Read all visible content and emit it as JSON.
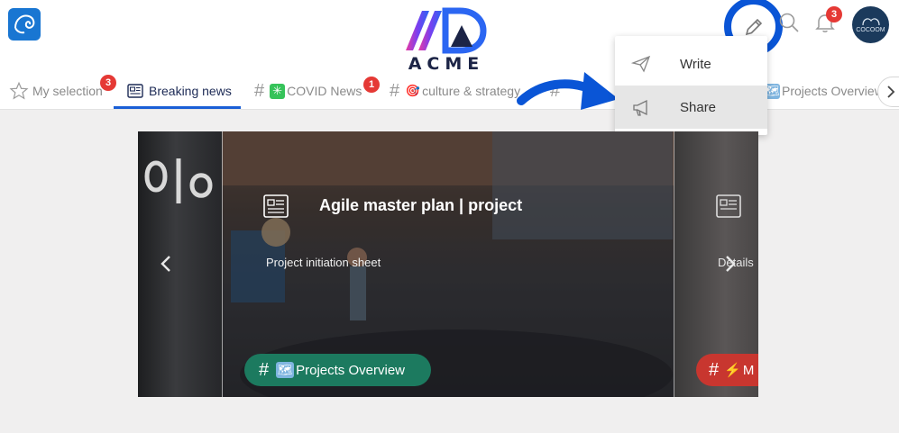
{
  "header": {
    "brand_name": "ACME",
    "notifications_count": "3",
    "avatar_label": "COCOOM"
  },
  "menu": {
    "items": [
      {
        "label": "Write",
        "icon": "paper-plane-icon"
      },
      {
        "label": "Share",
        "icon": "megaphone-icon"
      }
    ]
  },
  "tabs": [
    {
      "label": "My selection",
      "badge": "3",
      "icon": "star-icon"
    },
    {
      "label": "Breaking news",
      "icon": "newspaper-icon",
      "active": true
    },
    {
      "label": "COVID News",
      "badge": "1",
      "icon": "hash-icon",
      "emoji": "✳"
    },
    {
      "label": "culture & strategy",
      "icon": "hash-icon",
      "emoji": "🎯"
    },
    {
      "label": "Projects Overview",
      "icon": "hash-icon",
      "emoji": "🗺"
    }
  ],
  "carousel": {
    "current": {
      "title": "Agile master plan | project",
      "subtitle": "Project initiation sheet",
      "chip": "Projects Overview",
      "chip_emoji": "🗺"
    },
    "next": {
      "subtitle": "Details",
      "chip_emoji": "⚡",
      "chip_text": "M"
    }
  },
  "colors": {
    "accent": "#1a5fd6",
    "badge": "#e53935",
    "chip_green": "#1c7a5f",
    "chip_red": "#c8362f",
    "highlight_ring": "#0a55d6"
  }
}
